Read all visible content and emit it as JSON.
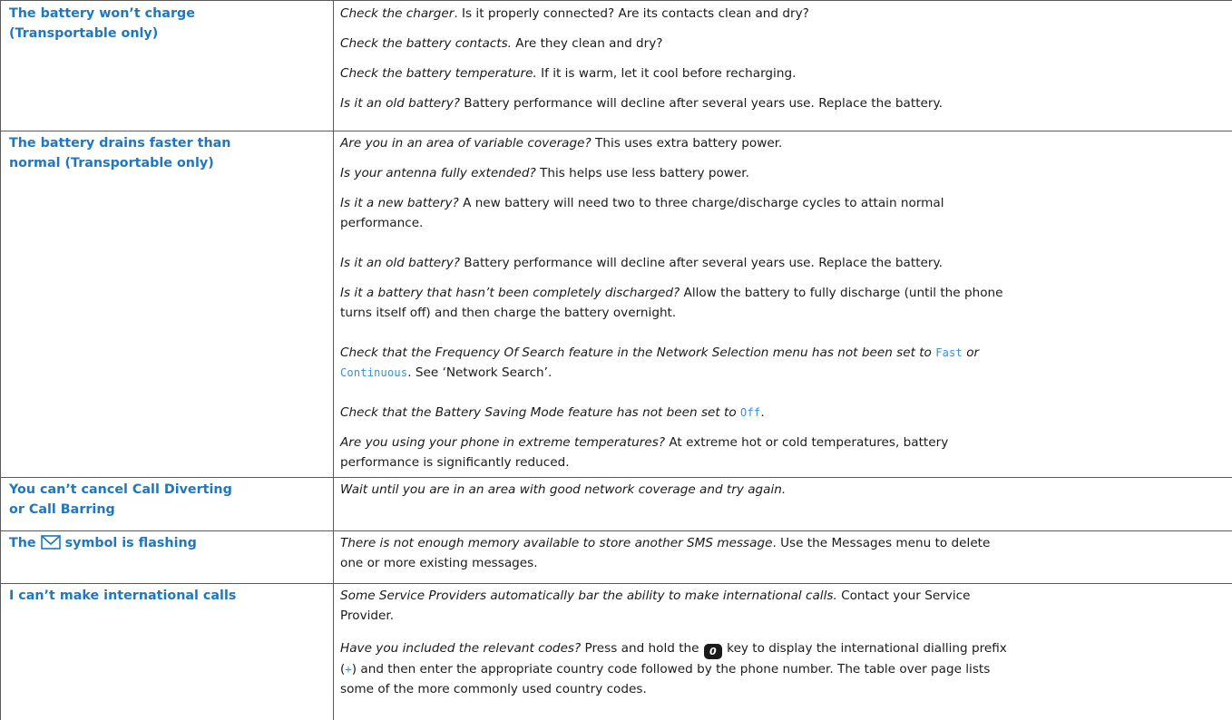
{
  "rows": [
    {
      "problem": [
        "The battery won’t charge",
        "(Transportable only)"
      ],
      "paras": [
        {
          "em": "Check the charger",
          "text": ". Is it properly connected? Are its contacts clean and dry?"
        },
        {
          "em": "Check the battery contacts.",
          "text": " Are they clean and dry?"
        },
        {
          "em": "Check the battery temperature.",
          "text": " If it is warm, let it cool before recharging."
        },
        {
          "em": "Is it an old battery?",
          "text": " Battery performance will decline after several years use. Replace the battery."
        }
      ]
    },
    {
      "problem": [
        "The battery drains faster than",
        "normal (Transportable only)"
      ],
      "paras": [
        {
          "em": "Are you in an area of variable coverage?",
          "text": " This uses extra battery power."
        },
        {
          "em": "Is your antenna fully extended?",
          "text": " This helps use less battery power."
        },
        {
          "em": "Is it a new battery?",
          "text1": " A new battery will need two to three charge/discharge cycles to attain normal",
          "text2": "performance."
        },
        {
          "em": "Is it an old battery?",
          "text": " Battery performance will decline after several years use. Replace the battery."
        },
        {
          "em": "Is it a battery that hasn’t been completely discharged?",
          "text1": " Allow the battery to fully discharge (until the phone",
          "text2": "turns itself off) and then charge the battery overnight."
        },
        {
          "em": "Check that the Frequency Of Search feature in the Network Selection menu has not been set to",
          "lcd1": "Fast",
          "em2": " or",
          "lcd2": "Continuous",
          "text": ". See ‘Network Search’."
        },
        {
          "em": "Check that the Battery Saving Mode feature has not been set to",
          "lcd": "Off",
          "text": "."
        },
        {
          "em": "Are you using your phone in extreme temperatures?",
          "text1": " At extreme hot or cold temperatures, battery",
          "text2": "performance is significantly reduced."
        }
      ]
    },
    {
      "problem": [
        "You can’t cancel Call Diverting",
        "or Call Barring"
      ],
      "paras": [
        {
          "em": "Wait until you are in an area with good network coverage and try again."
        }
      ]
    },
    {
      "problem": [
        "The",
        "symbol is flashing"
      ],
      "icon": "envelope-icon",
      "paras": [
        {
          "em": "There is not enough memory available to store another SMS message",
          "text1": ". Use the Messages menu to delete",
          "text2": "one or more existing messages."
        }
      ]
    },
    {
      "problem": [
        "I can’t make international calls"
      ],
      "paras": [
        {
          "em": "Some Service Providers automatically bar the ability to make international calls.",
          "text1": " Contact your Service",
          "text2": "Provider."
        },
        {
          "em": "Have you included the relevant codes?",
          "text1": " Press and hold the",
          "key": "0",
          "text2": " key to display the international dialling prefix",
          "text3": "(",
          "lcd": "+",
          "text4": ") and then enter the appropriate country code followed by the phone number. The table over page lists",
          "text5": "some of the more commonly used country codes."
        }
      ]
    }
  ],
  "colors": {
    "heading": "#1f78bf",
    "lcd": "#3b8ed6",
    "rule": "#5a5a5a"
  }
}
